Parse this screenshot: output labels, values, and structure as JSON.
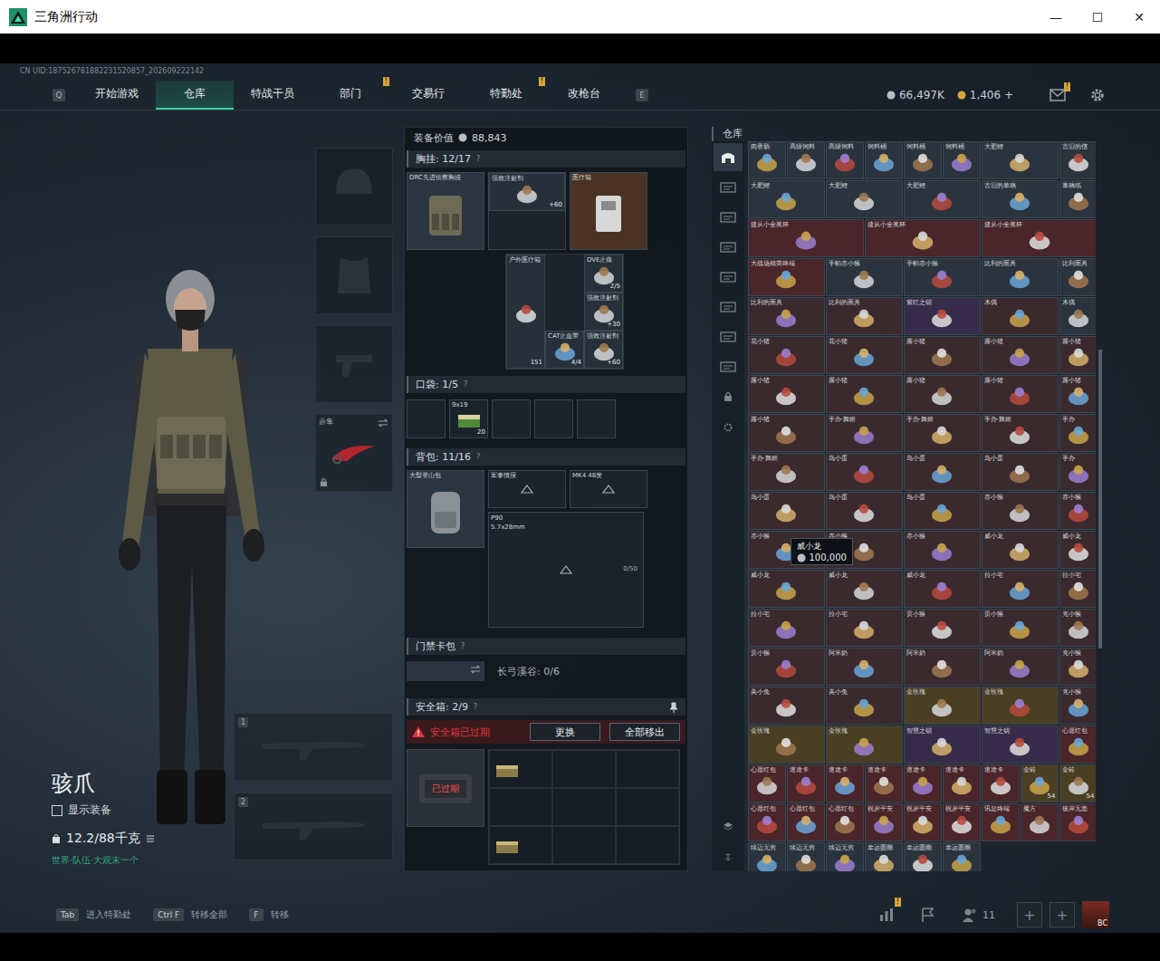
{
  "window": {
    "title": "三角洲行动",
    "controls": [
      "—",
      "☐",
      "✕"
    ]
  },
  "uid": "CN UID:187526781882231520857_202609222142",
  "nav": {
    "left_key": "Q",
    "right_key": "E",
    "tabs": [
      {
        "label": "开始游戏",
        "selected": false,
        "badge": ""
      },
      {
        "label": "仓库",
        "selected": true,
        "badge": ""
      },
      {
        "label": "特战干员",
        "selected": false,
        "badge": ""
      },
      {
        "label": "部门",
        "selected": false,
        "badge": "!"
      },
      {
        "label": "交易行",
        "selected": false,
        "badge": ""
      },
      {
        "label": "特勤处",
        "selected": false,
        "badge": "!"
      },
      {
        "label": "改枪台",
        "selected": false,
        "badge": ""
      }
    ]
  },
  "currency": [
    {
      "value": "66,497K",
      "color": "#b8bec4"
    },
    {
      "value": "1,406 +",
      "color": "#d9a53a"
    }
  ],
  "mail_badge": "!",
  "operator": {
    "name": "骇爪",
    "show_equipment": {
      "label": "显示装备",
      "checked": false
    },
    "weight": "12.2/88千克",
    "status": "世界·队伍·大观末一个"
  },
  "slots": {
    "melee": {
      "label": "赤隼",
      "locked": true
    },
    "weapons": [
      "1",
      "2"
    ]
  },
  "loadout": {
    "value_label": "装备价值",
    "value": "88,843",
    "chest": {
      "title": "胸挂",
      "capacity": "12/17",
      "help": "?",
      "rig": "DRC先进侦察胸挂",
      "top": [
        {
          "name": "强效注射剂",
          "qty": "+60"
        },
        {
          "name": "医疗箱",
          "qty": ""
        }
      ],
      "grid": [
        {
          "name": "户外医疗箱",
          "qty": "151"
        },
        {
          "name": "CAT止血带",
          "qty": "4/4"
        },
        {
          "name": "DVE止痛",
          "qty": "2/5"
        },
        {
          "name": "强效注射剂",
          "qty": "+30"
        },
        {
          "name": "强效注射剂",
          "qty": "+60"
        }
      ]
    },
    "pocket": {
      "title": "口袋",
      "capacity": "1/5",
      "help": "?",
      "slots": [
        {
          "empty": true,
          "name": "",
          "qty": ""
        },
        {
          "empty": false,
          "name": "9x19",
          "qty": "20"
        },
        {
          "empty": true,
          "name": "",
          "qty": ""
        },
        {
          "empty": true,
          "name": "",
          "qty": ""
        },
        {
          "empty": true,
          "name": "",
          "qty": ""
        }
      ]
    },
    "backpack": {
      "title": "背包",
      "capacity": "11/16",
      "help": "?",
      "bag": "大型登山包",
      "items": [
        {
          "name": "军事情报"
        },
        {
          "name": "MK4 48发"
        }
      ],
      "big": {
        "name": "P90",
        "sub": "5.7x28mm",
        "qty": "0/50"
      }
    },
    "keycard": {
      "title": "门禁卡包",
      "help": "?",
      "map": "长弓溪谷: 0/6"
    },
    "safebox": {
      "title": "安全箱",
      "capacity": "2/9",
      "help": "?",
      "warning": "安全箱已过期",
      "buttons": [
        "更换",
        "全部移出"
      ],
      "case_label": "已过期",
      "cells": [
        {
          "filled": true
        },
        {
          "filled": false
        },
        {
          "filled": false
        },
        {
          "filled": false
        },
        {
          "filled": false
        },
        {
          "filled": false
        },
        {
          "filled": true
        },
        {
          "filled": false
        },
        {
          "filled": false
        }
      ]
    }
  },
  "stash": {
    "title": "仓库",
    "tabs": [
      {
        "selected": true
      },
      {
        "selected": false
      },
      {
        "selected": false
      },
      {
        "selected": false
      },
      {
        "selected": false
      },
      {
        "selected": false
      },
      {
        "selected": false
      },
      {
        "selected": false
      }
    ],
    "tooltip": {
      "name": "威小龙",
      "price": "100,000"
    },
    "items": [
      {
        "name": "肉香肠",
        "kind": "single",
        "color": "#2b343e",
        "count": ""
      },
      {
        "name": "高级饲料",
        "kind": "single",
        "color": "#2b343e",
        "count": ""
      },
      {
        "name": "高级饲料",
        "kind": "single",
        "color": "#2b343e",
        "count": ""
      },
      {
        "name": "饲料桶",
        "kind": "single",
        "color": "#2b343e",
        "count": ""
      },
      {
        "name": "饲料桶",
        "kind": "single",
        "color": "#2b343e",
        "count": ""
      },
      {
        "name": "饲料桶",
        "kind": "single",
        "color": "#2b343e",
        "count": ""
      },
      {
        "name": "大肥鲤",
        "kind": "wide",
        "color": "#2b343e",
        "count": ""
      },
      {
        "name": "古旧的信",
        "kind": "single",
        "color": "#2b343e",
        "count": ""
      },
      {
        "name": "大肥鲤",
        "kind": "wide",
        "color": "#2b343e",
        "count": ""
      },
      {
        "name": "大肥鲤",
        "kind": "wide",
        "color": "#2b343e",
        "count": ""
      },
      {
        "name": "大肥鲤",
        "kind": "wide",
        "color": "#2b343e",
        "count": ""
      },
      {
        "name": "古旧的草稿",
        "kind": "wide",
        "color": "#2b343e",
        "count": ""
      },
      {
        "name": "草稿纸",
        "kind": "single",
        "color": "#2b343e",
        "count": ""
      },
      {
        "name": "捷从小全奖杯",
        "kind": "trophy",
        "color": "#4a2529",
        "count": ""
      },
      {
        "name": "捷从小全奖杯",
        "kind": "trophy",
        "color": "#4a2529",
        "count": ""
      },
      {
        "name": "捷从小全奖杯",
        "kind": "trophy",
        "color": "#4a2529",
        "count": ""
      },
      {
        "name": "大战场精英终端",
        "kind": "wide",
        "color": "#4a2529",
        "count": ""
      },
      {
        "name": "手帕赤小猴",
        "kind": "wide",
        "color": "#2b343e",
        "count": ""
      },
      {
        "name": "手帕赤小猴",
        "kind": "wide",
        "color": "#2b343e",
        "count": ""
      },
      {
        "name": "比利的面具",
        "kind": "wide",
        "color": "#2b343e",
        "count": ""
      },
      {
        "name": "比利面具",
        "kind": "single",
        "color": "#2b343e",
        "count": ""
      },
      {
        "name": "比利的面具",
        "kind": "wide",
        "color": "#3a2a2e",
        "count": ""
      },
      {
        "name": "比利的面具",
        "kind": "wide",
        "color": "#3a2a2e",
        "count": ""
      },
      {
        "name": "紫红之钥",
        "kind": "wide",
        "color": "#362c4a",
        "count": ""
      },
      {
        "name": "木偶",
        "kind": "wide",
        "color": "#3a2a2e",
        "count": ""
      },
      {
        "name": "木偶",
        "kind": "single",
        "color": "#2b343e",
        "count": ""
      },
      {
        "name": "花小猪",
        "kind": "wide",
        "color": "#3a2a2e",
        "count": ""
      },
      {
        "name": "花小猪",
        "kind": "wide",
        "color": "#3a2a2e",
        "count": ""
      },
      {
        "name": "露小猪",
        "kind": "wide",
        "color": "#3a2a2e",
        "count": ""
      },
      {
        "name": "露小猪",
        "kind": "wide",
        "color": "#3a2a2e",
        "count": ""
      },
      {
        "name": "露小猪",
        "kind": "single",
        "color": "#3a2a2e",
        "count": ""
      },
      {
        "name": "露小猪",
        "kind": "wide",
        "color": "#3a2a2e",
        "count": ""
      },
      {
        "name": "露小猪",
        "kind": "wide",
        "color": "#3a2a2e",
        "count": ""
      },
      {
        "name": "露小猪",
        "kind": "wide",
        "color": "#3a2a2e",
        "count": ""
      },
      {
        "name": "露小猪",
        "kind": "wide",
        "color": "#3a2a2e",
        "count": ""
      },
      {
        "name": "露小猪",
        "kind": "single",
        "color": "#3a2a2e",
        "count": ""
      },
      {
        "name": "露小猪",
        "kind": "wide",
        "color": "#3a2a2e",
        "count": ""
      },
      {
        "name": "手办·舞姬",
        "kind": "wide",
        "color": "#3a2a2e",
        "count": ""
      },
      {
        "name": "手办·舞姬",
        "kind": "wide",
        "color": "#3a2a2e",
        "count": ""
      },
      {
        "name": "手办·舞姬",
        "kind": "wide",
        "color": "#3a2a2e",
        "count": ""
      },
      {
        "name": "手办",
        "kind": "single",
        "color": "#3a2a2e",
        "count": ""
      },
      {
        "name": "手办·舞姬",
        "kind": "wide",
        "color": "#3a2a2e",
        "count": ""
      },
      {
        "name": "鸟小蛋",
        "kind": "wide",
        "color": "#3a2a2e",
        "count": ""
      },
      {
        "name": "鸟小蛋",
        "kind": "wide",
        "color": "#3a2a2e",
        "count": ""
      },
      {
        "name": "鸟小蛋",
        "kind": "wide",
        "color": "#3a2a2e",
        "count": ""
      },
      {
        "name": "手办",
        "kind": "single",
        "color": "#3a2a2e",
        "count": ""
      },
      {
        "name": "鸟小蛋",
        "kind": "wide",
        "color": "#3a2a2e",
        "count": ""
      },
      {
        "name": "鸟小蛋",
        "kind": "wide",
        "color": "#3a2a2e",
        "count": ""
      },
      {
        "name": "鸟小蛋",
        "kind": "wide",
        "color": "#3a2a2e",
        "count": ""
      },
      {
        "name": "赤小猴",
        "kind": "wide",
        "color": "#3a2a2e",
        "count": ""
      },
      {
        "name": "赤小猴",
        "kind": "single",
        "color": "#3a2a2e",
        "count": ""
      },
      {
        "name": "赤小猴",
        "kind": "wide",
        "color": "#3a2a2e",
        "count": ""
      },
      {
        "name": "赤小猴",
        "kind": "wide",
        "color": "#3a2a2e",
        "count": ""
      },
      {
        "name": "赤小猴",
        "kind": "wide",
        "color": "#3a2a2e",
        "count": ""
      },
      {
        "name": "威小龙",
        "kind": "wide",
        "color": "#3a2a2e",
        "count": ""
      },
      {
        "name": "威小龙",
        "kind": "single",
        "color": "#3a2a2e",
        "count": ""
      },
      {
        "name": "威小龙",
        "kind": "wide",
        "color": "#3a2a2e",
        "count": ""
      },
      {
        "name": "威小龙",
        "kind": "wide",
        "color": "#3a2a2e",
        "count": ""
      },
      {
        "name": "威小龙",
        "kind": "wide",
        "color": "#3a2a2e",
        "count": ""
      },
      {
        "name": "拉小宅",
        "kind": "wide",
        "color": "#3a2a2e",
        "count": ""
      },
      {
        "name": "拉小宅",
        "kind": "single",
        "color": "#3a2a2e",
        "count": ""
      },
      {
        "name": "拉小宅",
        "kind": "wide",
        "color": "#3a2a2e",
        "count": ""
      },
      {
        "name": "拉小宅",
        "kind": "wide",
        "color": "#3a2a2e",
        "count": ""
      },
      {
        "name": "贡小猴",
        "kind": "wide",
        "color": "#3a2a2e",
        "count": ""
      },
      {
        "name": "贡小猴",
        "kind": "wide",
        "color": "#3a2a2e",
        "count": ""
      },
      {
        "name": "克小猴",
        "kind": "single",
        "color": "#3a2a2e",
        "count": ""
      },
      {
        "name": "贡小猴",
        "kind": "wide",
        "color": "#3a2a2e",
        "count": ""
      },
      {
        "name": "阿米奶",
        "kind": "wide",
        "color": "#3a2a2e",
        "count": ""
      },
      {
        "name": "阿米奶",
        "kind": "wide",
        "color": "#3a2a2e",
        "count": ""
      },
      {
        "name": "阿米奶",
        "kind": "wide",
        "color": "#3a2a2e",
        "count": ""
      },
      {
        "name": "克小猴",
        "kind": "single",
        "color": "#3a2a2e",
        "count": ""
      },
      {
        "name": "美小兔",
        "kind": "wide",
        "color": "#3a2a2e",
        "count": ""
      },
      {
        "name": "美小兔",
        "kind": "wide",
        "color": "#3a2a2e",
        "count": ""
      },
      {
        "name": "金玫瑰",
        "kind": "wide",
        "color": "#4a3e23",
        "count": ""
      },
      {
        "name": "金玫瑰",
        "kind": "wide",
        "color": "#4a3e23",
        "count": ""
      },
      {
        "name": "克小猴",
        "kind": "single",
        "color": "#3a2a2e",
        "count": ""
      },
      {
        "name": "金玫瑰",
        "kind": "wide",
        "color": "#4a3e23",
        "count": ""
      },
      {
        "name": "金玫瑰",
        "kind": "wide",
        "color": "#4a3e23",
        "count": ""
      },
      {
        "name": "智慧之钥",
        "kind": "wide",
        "color": "#362c4a",
        "count": ""
      },
      {
        "name": "智慧之钥",
        "kind": "wide",
        "color": "#362c4a",
        "count": ""
      },
      {
        "name": "心愿红包",
        "kind": "single",
        "color": "#4a2529",
        "count": ""
      },
      {
        "name": "心愿红包",
        "kind": "single",
        "color": "#4a2529",
        "count": ""
      },
      {
        "name": "道途卡",
        "kind": "single",
        "color": "#4a2529",
        "count": ""
      },
      {
        "name": "道途卡",
        "kind": "single",
        "color": "#4a2529",
        "count": ""
      },
      {
        "name": "道途卡",
        "kind": "single",
        "color": "#4a2529",
        "count": ""
      },
      {
        "name": "道途卡",
        "kind": "single",
        "color": "#4a2529",
        "count": ""
      },
      {
        "name": "道途卡",
        "kind": "single",
        "color": "#4a2529",
        "count": ""
      },
      {
        "name": "道途卡",
        "kind": "single",
        "color": "#4a2529",
        "count": ""
      },
      {
        "name": "金砖",
        "kind": "single",
        "color": "#4a3e23",
        "count": "54"
      },
      {
        "name": "金砖",
        "kind": "single",
        "color": "#4a3e23",
        "count": "54"
      },
      {
        "name": "心愿红包",
        "kind": "single",
        "color": "#4a2529",
        "count": ""
      },
      {
        "name": "心愿红包",
        "kind": "single",
        "color": "#4a2529",
        "count": ""
      },
      {
        "name": "心愿红包",
        "kind": "single",
        "color": "#4a2529",
        "count": ""
      },
      {
        "name": "祝岁平安",
        "kind": "single",
        "color": "#4a2529",
        "count": ""
      },
      {
        "name": "祝岁平安",
        "kind": "single",
        "color": "#4a2529",
        "count": ""
      },
      {
        "name": "祝岁平安",
        "kind": "single",
        "color": "#4a2529",
        "count": ""
      },
      {
        "name": "讯息终端",
        "kind": "single",
        "color": "#4a2529",
        "count": ""
      },
      {
        "name": "魔方",
        "kind": "single",
        "color": "#4a2529",
        "count": ""
      },
      {
        "name": "彼岸无恙",
        "kind": "single",
        "color": "#4a2529",
        "count": ""
      },
      {
        "name": "续迈无穷",
        "kind": "single",
        "color": "#2b343e",
        "count": ""
      },
      {
        "name": "续迈无穷",
        "kind": "single",
        "color": "#2b343e",
        "count": ""
      },
      {
        "name": "续迈无穷",
        "kind": "single",
        "color": "#2b343e",
        "count": ""
      },
      {
        "name": "幸运圆圈",
        "kind": "single",
        "color": "#2b343e",
        "count": ""
      },
      {
        "name": "幸运圆圈",
        "kind": "single",
        "color": "#2b343e",
        "count": ""
      },
      {
        "name": "幸运圆圈",
        "kind": "single",
        "color": "#2b343e",
        "count": ""
      }
    ]
  },
  "hotkeys": [
    {
      "key": "Tab",
      "label": "进入特勤处"
    },
    {
      "key": "Ctrl F",
      "label": "转移全部"
    },
    {
      "key": "F",
      "label": "转移"
    }
  ],
  "footer": {
    "stats_badge": "!",
    "friends": "11",
    "plus_buttons": [
      "+",
      "+"
    ],
    "avatar": "BC"
  }
}
